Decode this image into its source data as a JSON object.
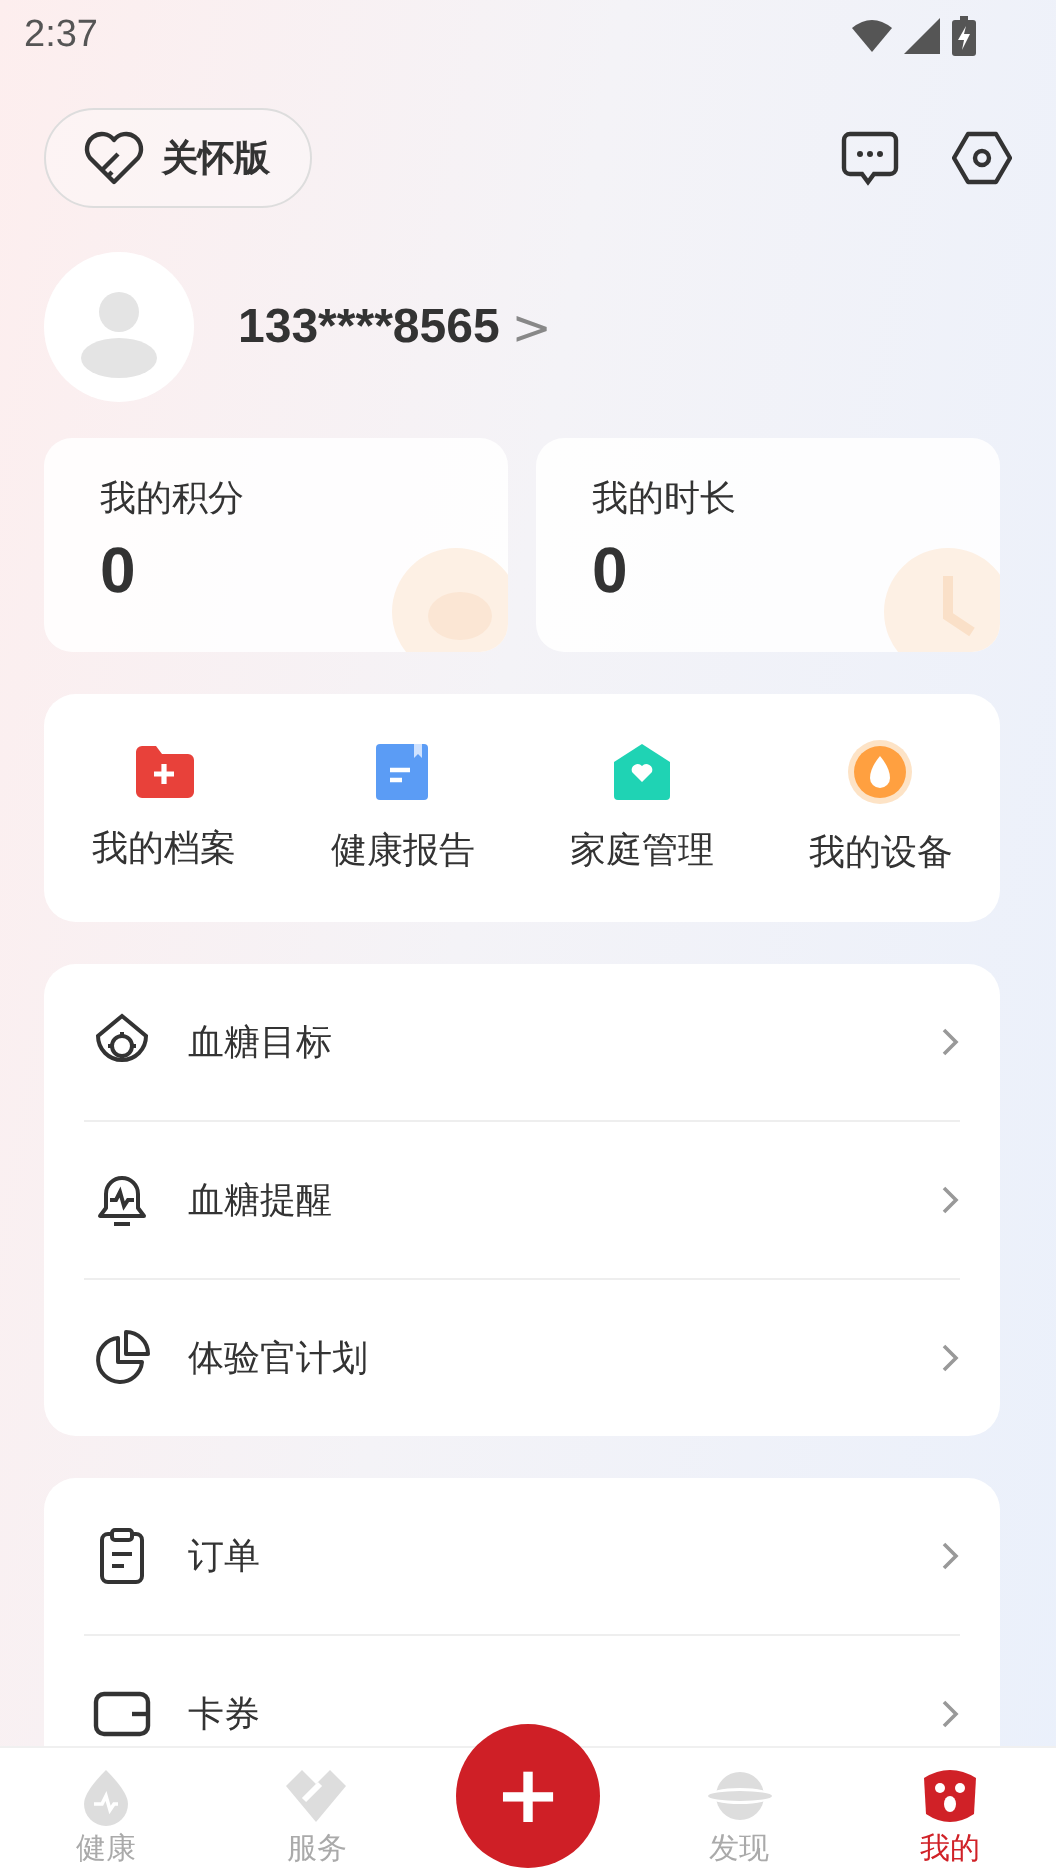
{
  "status_bar": {
    "time": "2:37"
  },
  "care_mode": {
    "label": "关怀版"
  },
  "profile": {
    "phone": "133****8565",
    "chevron": ">"
  },
  "stats": [
    {
      "kind": "points",
      "label": "我的积分",
      "value": "0"
    },
    {
      "kind": "duration",
      "label": "我的时长",
      "value": "0"
    }
  ],
  "shortcuts": [
    {
      "kind": "archive",
      "label": "我的档案"
    },
    {
      "kind": "report",
      "label": "健康报告"
    },
    {
      "kind": "family",
      "label": "家庭管理"
    },
    {
      "kind": "device",
      "label": "我的设备"
    }
  ],
  "menu_groups": [
    [
      {
        "kind": "target",
        "label": "血糖目标"
      },
      {
        "kind": "reminder",
        "label": "血糖提醒"
      },
      {
        "kind": "pie",
        "label": "体验官计划"
      }
    ],
    [
      {
        "kind": "order",
        "label": "订单"
      },
      {
        "kind": "wallet",
        "label": "卡券"
      }
    ]
  ],
  "tab_bar": {
    "tabs": [
      {
        "kind": "health",
        "label": "健康",
        "selected": false
      },
      {
        "kind": "service",
        "label": "服务",
        "selected": false
      },
      {
        "kind": "add",
        "label": "+",
        "selected": false
      },
      {
        "kind": "discover",
        "label": "发现",
        "selected": false
      },
      {
        "kind": "mine",
        "label": "我的",
        "selected": true
      }
    ]
  }
}
